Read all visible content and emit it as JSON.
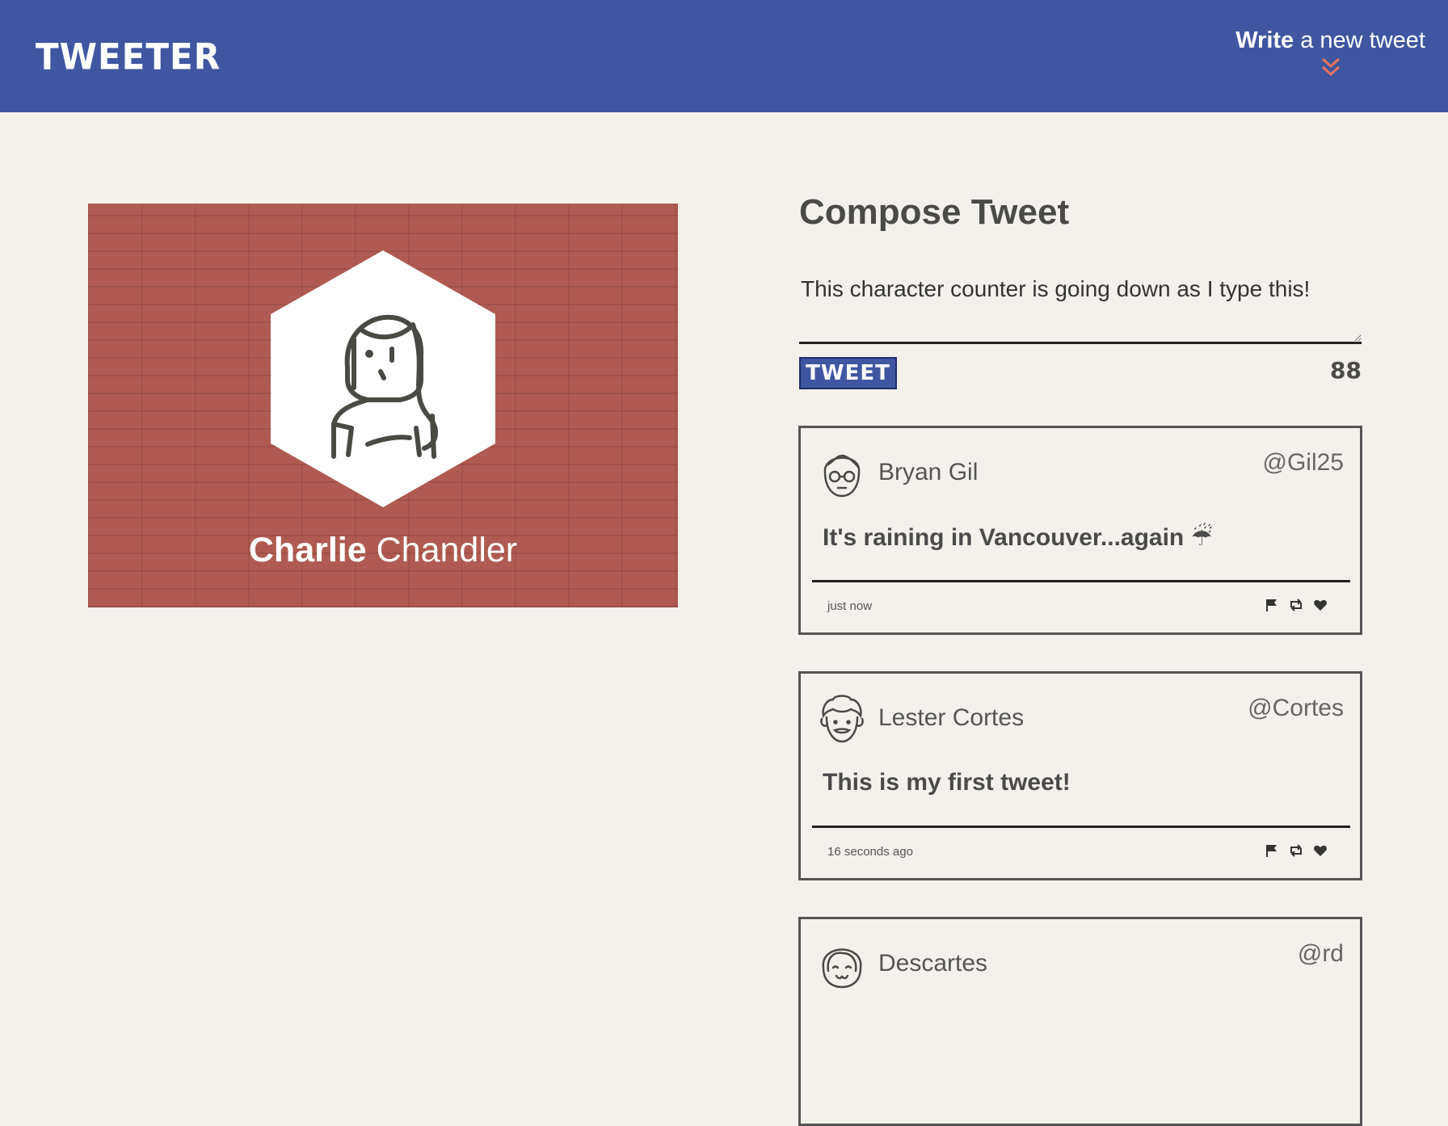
{
  "nav": {
    "brand": "TWEETER",
    "write_bold": "Write",
    "write_rest": " a new tweet"
  },
  "profile": {
    "first_name": "Charlie",
    "last_name": "Chandler",
    "background_color": "#b05b51"
  },
  "compose": {
    "title": "Compose Tweet",
    "text": "This character counter is going down as I type this!",
    "button_label": "TWEET",
    "counter": "88"
  },
  "tweets": [
    {
      "name": "Bryan Gil",
      "handle": "@Gil25",
      "body": "It's raining in Vancouver...again ☔",
      "time": "just now",
      "avatar_icon": "bespectacled-man-avatar-icon"
    },
    {
      "name": "Lester Cortes",
      "handle": "@Cortes",
      "body": "This is my first tweet!",
      "time": "16 seconds ago",
      "avatar_icon": "curly-hair-man-avatar-icon"
    },
    {
      "name": "Descartes",
      "handle": "@rd",
      "body": "",
      "time": "",
      "avatar_icon": "bob-hair-avatar-icon"
    }
  ],
  "colors": {
    "nav_bg": "#4056a1",
    "page_bg": "#f4f1ec",
    "accent_chevron": "#e8735c"
  }
}
